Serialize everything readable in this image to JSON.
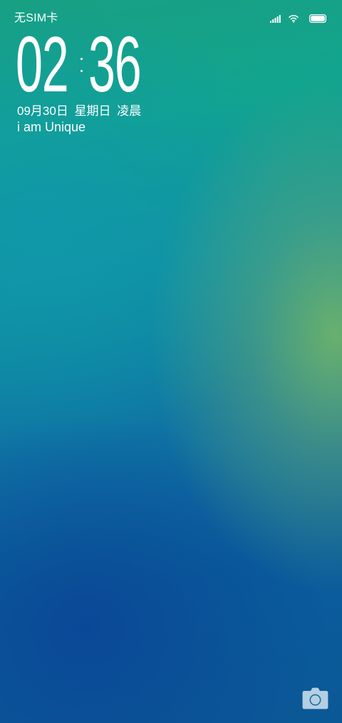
{
  "status_bar": {
    "carrier": "无SIM卡",
    "icons": [
      "signal-icon",
      "wifi-icon",
      "battery-icon"
    ]
  },
  "clock": {
    "hours": "02",
    "minutes": "36"
  },
  "date": {
    "date": "09月30日",
    "weekday": "星期日",
    "period": "凌晨"
  },
  "signature": "i am Unique",
  "shortcuts": {
    "camera_icon": "camera-icon"
  },
  "colors": {
    "text": "#ffffff",
    "gradient_top": "#18a083",
    "gradient_mid": "#0e8ea3",
    "gradient_bottom": "#0b5896",
    "accent_green": "#78b964"
  }
}
